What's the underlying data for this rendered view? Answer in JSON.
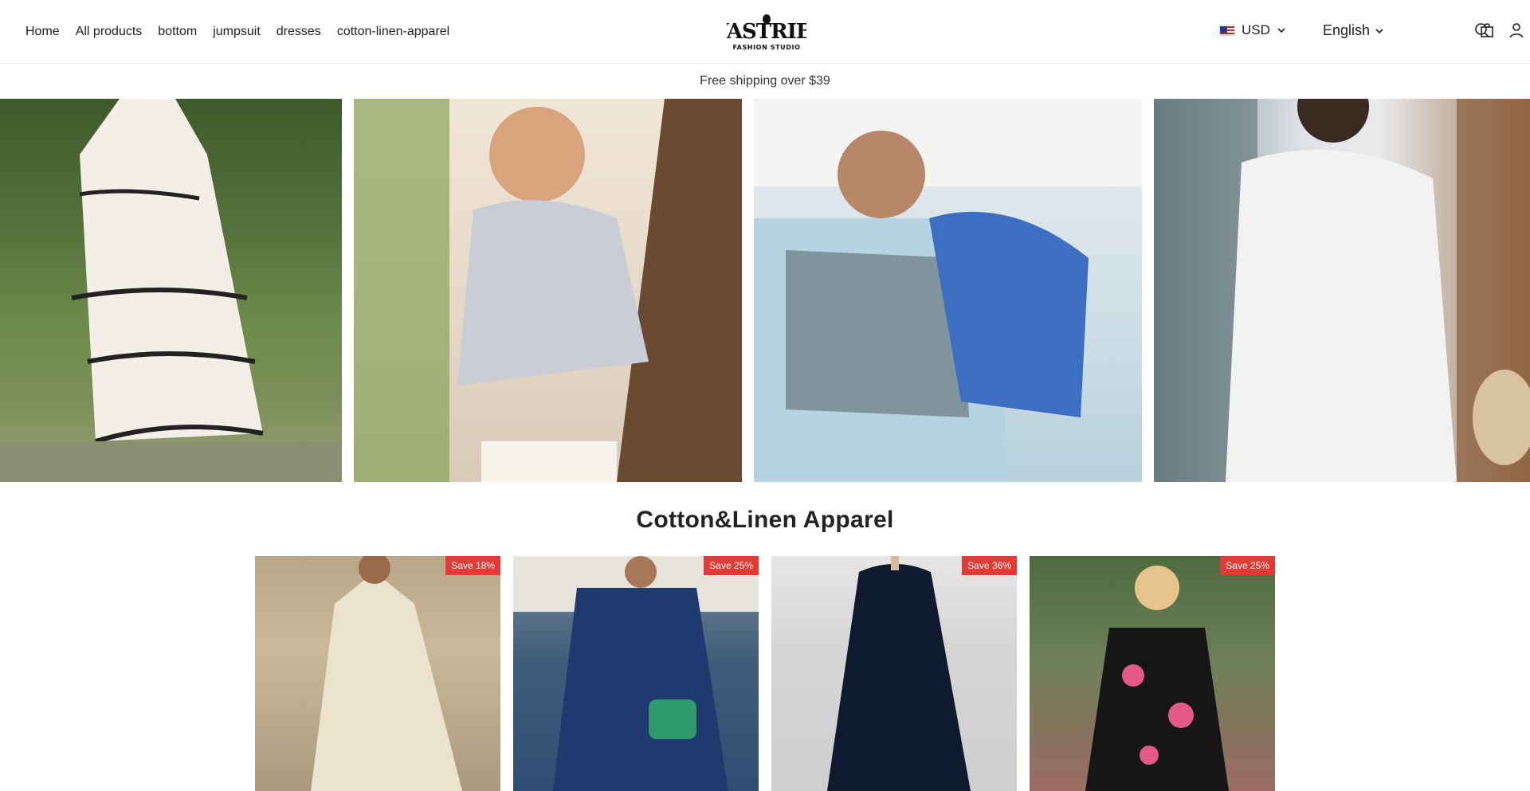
{
  "nav": {
    "items": [
      {
        "label": "Home"
      },
      {
        "label": "All products"
      },
      {
        "label": "bottom"
      },
      {
        "label": "jumpsuit"
      },
      {
        "label": "dresses"
      },
      {
        "label": "cotton-linen-apparel"
      }
    ]
  },
  "logo": {
    "brand": "WASTRIBE",
    "tagline": "FASHION STUDIO"
  },
  "tools": {
    "currency": "USD",
    "language": "English",
    "icons": [
      "search-icon",
      "account-icon",
      "cart-icon"
    ]
  },
  "announcement": {
    "text": "Free shipping over $39"
  },
  "hero": {
    "panels": [
      "white ric-rac sundress",
      "striped puff sleeve blouse",
      "blue floral dress in jeep",
      "white eyelet dress"
    ]
  },
  "section": {
    "title": "Cotton&Linen Apparel"
  },
  "products": [
    {
      "badge": "Save 18%"
    },
    {
      "badge": "Save 25%"
    },
    {
      "badge": "Save 36%"
    },
    {
      "badge": "Save 25%"
    }
  ],
  "colors": {
    "badge_red": "#e53935",
    "text": "#222222"
  }
}
